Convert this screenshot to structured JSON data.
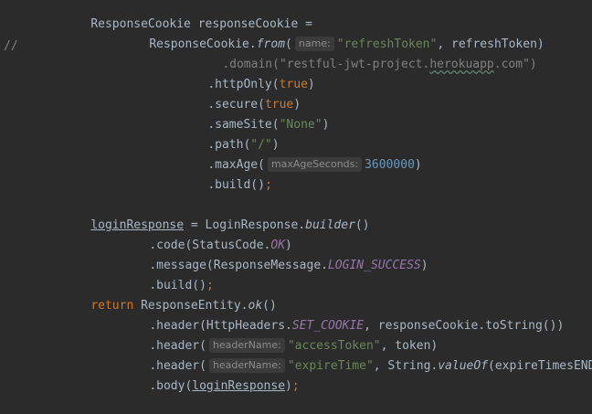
{
  "editor": {
    "comment_marker": "//",
    "lines": {
      "l1": {
        "text": "ResponseCookie responseCookie ="
      },
      "l2": {
        "a": "ResponseCookie.",
        "b": "from",
        "c": "(",
        "hint": "name:",
        "str": "\"refreshToken\"",
        "d": ", refreshToken)"
      },
      "l3": {
        "a": ".domain(",
        "str_a": "\"restful-jwt-project.",
        "str_b": "herokuapp",
        "str_c": ".com\"",
        "b": ")"
      },
      "l4": {
        "a": ".httpOnly(",
        "kw": "true",
        "b": ")"
      },
      "l5": {
        "a": ".secure(",
        "kw": "true",
        "b": ")"
      },
      "l6": {
        "a": ".sameSite(",
        "str": "\"None\"",
        "b": ")"
      },
      "l7": {
        "a": ".path(",
        "str": "\"/\"",
        "b": ")"
      },
      "l8": {
        "a": ".maxAge(",
        "hint": "maxAgeSeconds:",
        "num": "3600000",
        "b": ")"
      },
      "l9": {
        "a": ".build()",
        "b": ";"
      },
      "l10": {
        "var": "loginResponse",
        "a": " = LoginResponse.",
        "fn": "builder",
        "b": "()"
      },
      "l11": {
        "a": ".code(StatusCode.",
        "const": "OK",
        "b": ")"
      },
      "l12": {
        "a": ".message(ResponseMessage.",
        "const": "LOGIN_SUCCESS",
        "b": ")"
      },
      "l13": {
        "a": ".build()",
        "b": ";"
      },
      "l14": {
        "kw": "return",
        "a": " ResponseEntity.",
        "fn": "ok",
        "b": "()"
      },
      "l15": {
        "a": ".header(HttpHeaders.",
        "const": "SET_COOKIE",
        "b": ", responseCookie.toString())"
      },
      "l16": {
        "a": ".header(",
        "hint": "headerName:",
        "str": "\"accessToken\"",
        "b": ", token)"
      },
      "l17": {
        "a": ".header(",
        "hint": "headerName:",
        "str": "\"expireTime\"",
        "b": ", String.",
        "fn": "valueOf",
        "c": "(expireTimesEND))"
      },
      "l18": {
        "a": ".body(",
        "var": "loginResponse",
        "b": ")",
        "c": ";"
      }
    }
  }
}
